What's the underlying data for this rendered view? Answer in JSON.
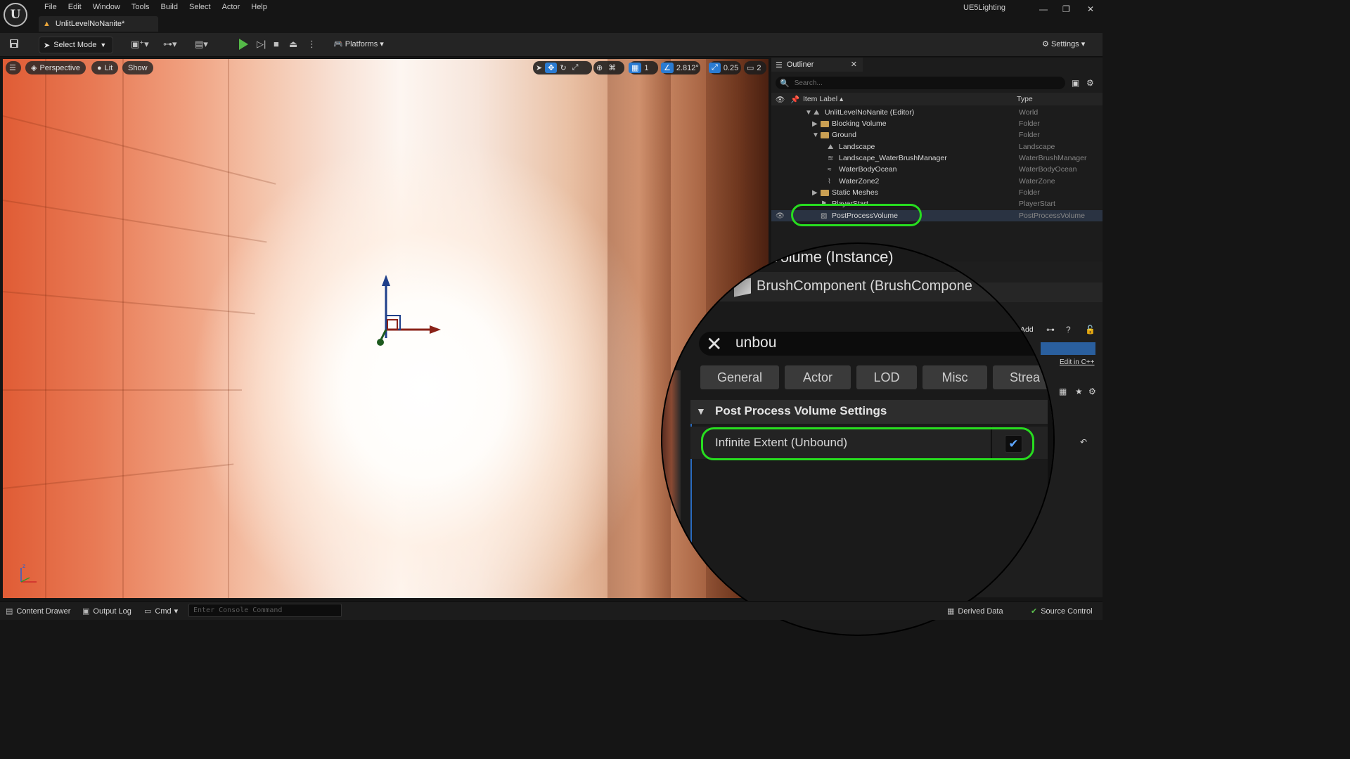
{
  "titlebar": {
    "logo_text": "U",
    "menu": [
      "File",
      "Edit",
      "Window",
      "Tools",
      "Build",
      "Select",
      "Actor",
      "Help"
    ],
    "level_tab": "UnlitLevelNoNanite*",
    "project": "UE5Lighting",
    "window_buttons": [
      "—",
      "❐",
      "✕"
    ]
  },
  "toolbar": {
    "select_mode": "Select Mode",
    "platforms": "Platforms",
    "settings": "Settings"
  },
  "viewport": {
    "perspective": "Perspective",
    "lit": "Lit",
    "show": "Show",
    "grid_value": "1",
    "angle_value": "2.812°",
    "scale_value": "0.25",
    "camera_speed": "2"
  },
  "outliner": {
    "tab_title": "Outliner",
    "search_placeholder": "Search...",
    "col_label": "Item Label ▴",
    "col_type": "Type",
    "rows": [
      {
        "name": "UnlitLevelNoNanite (Editor)",
        "type": "World"
      },
      {
        "name": "Blocking Volume",
        "type": "Folder"
      },
      {
        "name": "Ground",
        "type": "Folder"
      },
      {
        "name": "Landscape",
        "type": "Landscape"
      },
      {
        "name": "Landscape_WaterBrushManager",
        "type": "WaterBrushManager"
      },
      {
        "name": "WaterBodyOcean",
        "type": "WaterBodyOcean"
      },
      {
        "name": "WaterZone2",
        "type": "WaterZone"
      },
      {
        "name": "Static Meshes",
        "type": "Folder"
      },
      {
        "name": "PlayerStart",
        "type": "PlayerStart"
      },
      {
        "name": "PostProcessVolume",
        "type": "PostProcessVolume"
      }
    ]
  },
  "details": {
    "add_label": "Add",
    "edit_cpp": "Edit in C++"
  },
  "magnifier": {
    "instance_title": "cessVolume (Instance)",
    "component": "BrushComponent (BrushCompone",
    "search_value": "unbou",
    "filters": [
      "General",
      "Actor",
      "LOD",
      "Misc",
      "Strea"
    ],
    "section": "Post Process Volume Settings",
    "property": "Infinite Extent (Unbound)",
    "checked": "✔"
  },
  "statusbar": {
    "content_drawer": "Content Drawer",
    "output_log": "Output Log",
    "cmd": "Cmd",
    "console_placeholder": "Enter Console Command",
    "derived_data": "Derived Data",
    "source_control": "Source Control"
  },
  "colors": {
    "highlight": "#27dd1f",
    "accent_blue": "#2a7bd2",
    "play_green": "#55b948"
  }
}
